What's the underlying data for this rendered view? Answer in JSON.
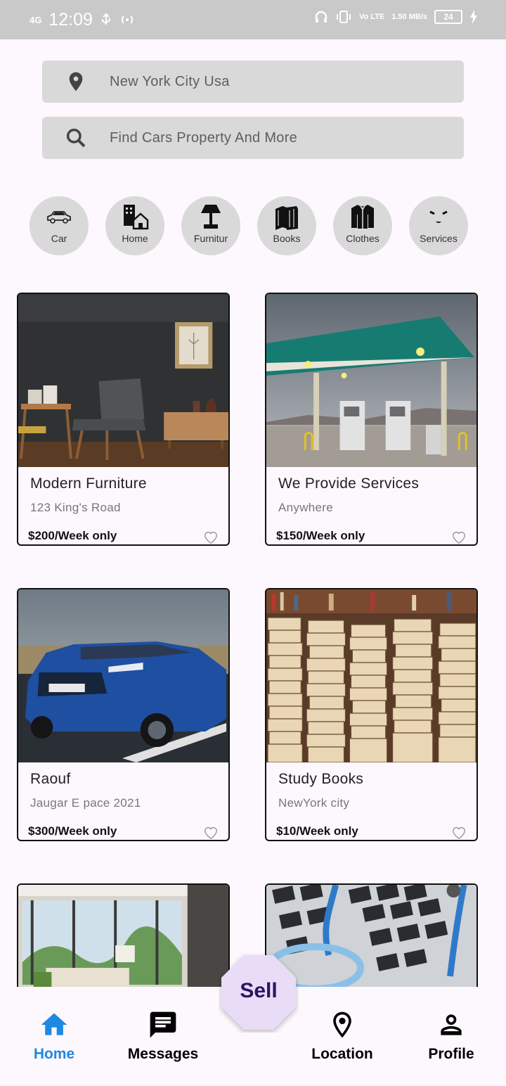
{
  "status_bar": {
    "signal": "4G",
    "time": "12:09",
    "network": "Vo LTE",
    "speed": "1.50 MB/s",
    "battery": "24"
  },
  "location_field": {
    "value": "New York City Usa",
    "icon": "location-pin-icon"
  },
  "search_field": {
    "placeholder": "Find Cars Property And More",
    "icon": "search-icon"
  },
  "categories": [
    {
      "label": "Car",
      "icon": "car-icon"
    },
    {
      "label": "Home",
      "icon": "home-icon"
    },
    {
      "label": "Furnitur",
      "icon": "lamp-icon"
    },
    {
      "label": "Books",
      "icon": "books-icon"
    },
    {
      "label": "Clothes",
      "icon": "jacket-icon"
    },
    {
      "label": "Services",
      "icon": "services-icon"
    }
  ],
  "listings": [
    {
      "title": "Modern Furniture",
      "subtitle": "123 King's Road",
      "price": "$200/Week only",
      "image": "furniture-photo"
    },
    {
      "title": "We Provide Services",
      "subtitle": "Anywhere",
      "price": "$150/Week only",
      "image": "gas-station-photo"
    },
    {
      "title": "Raouf",
      "subtitle": "Jaugar E pace 2021",
      "price": "$300/Week only",
      "image": "blue-suv-photo"
    },
    {
      "title": "Study Books",
      "subtitle": "NewYork city",
      "price": "$10/Week only",
      "image": "books-stack-photo"
    },
    {
      "title": "",
      "subtitle": "",
      "price": "",
      "image": "living-room-photo"
    },
    {
      "title": "",
      "subtitle": "",
      "price": "",
      "image": "keyboard-stethoscope-photo"
    }
  ],
  "bottom_nav": {
    "items": [
      {
        "label": "Home",
        "icon": "home-icon",
        "active": true
      },
      {
        "label": "Messages",
        "icon": "message-icon",
        "active": false
      },
      {
        "label": "Location",
        "icon": "location-pin-icon",
        "active": false
      },
      {
        "label": "Profile",
        "icon": "person-icon",
        "active": false
      }
    ],
    "sell_label": "Sell"
  },
  "colors": {
    "accent": "#1e88e5",
    "field_bg": "#d9d9d9",
    "sell_bg": "#e8dcf7",
    "sell_text": "#2b1560"
  }
}
